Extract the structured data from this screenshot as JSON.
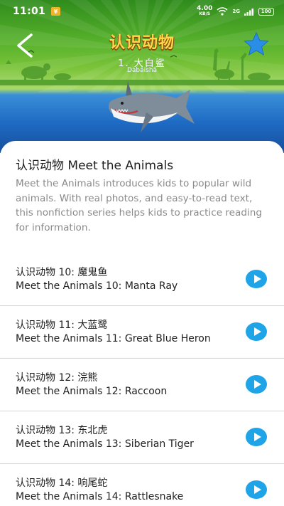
{
  "status_bar": {
    "time": "11:01",
    "notification_badge": "¥",
    "net_speed_value": "4.00",
    "net_speed_unit": "KB/S",
    "signal_label": "2G",
    "battery": "100"
  },
  "header": {
    "title": "认识动物",
    "subtitle": "1. 大白鲨",
    "pinyin": "Dàbáishā",
    "colors": {
      "title": "#ffd84a",
      "sky": "#58b22c",
      "water": "#1f6bc4",
      "star": "#2a8ee6"
    }
  },
  "card": {
    "title": "认识动物 Meet the Animals",
    "description": "Meet the Animals introduces kids to popular wild animals. With real photos, and easy-to-read text, this nonfiction series helps kids to practice reading for information."
  },
  "list": [
    {
      "cn": "认识动物 10: 魔鬼鱼",
      "en": "Meet the Animals 10: Manta Ray"
    },
    {
      "cn": "认识动物 11: 大蓝鹭",
      "en": "Meet the Animals 11: Great Blue Heron"
    },
    {
      "cn": "认识动物 12: 浣熊",
      "en": "Meet the Animals 12: Raccoon"
    },
    {
      "cn": "认识动物 13: 东北虎",
      "en": "Meet the Animals 13: Siberian Tiger"
    },
    {
      "cn": "认识动物 14: 响尾蛇",
      "en": "Meet the Animals 14: Rattlesnake"
    }
  ],
  "accent_color": "#1fa4e8"
}
